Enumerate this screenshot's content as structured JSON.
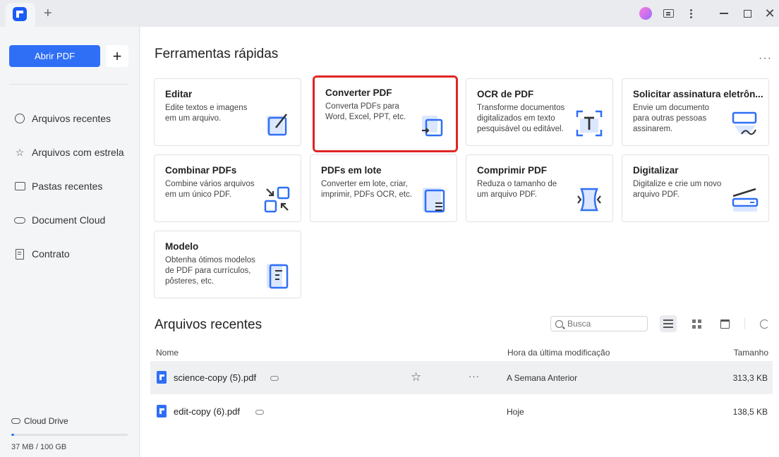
{
  "titlebar": {
    "new_tab": "+",
    "close": "✕"
  },
  "sidebar": {
    "open_button": "Abrir PDF",
    "add_button": "+",
    "items": [
      {
        "label": "Arquivos recentes",
        "icon": "clock-icon"
      },
      {
        "label": "Arquivos com estrela",
        "icon": "star-icon"
      },
      {
        "label": "Pastas recentes",
        "icon": "folder-icon"
      },
      {
        "label": "Document Cloud",
        "icon": "cloud-icon"
      },
      {
        "label": "Contrato",
        "icon": "document-icon"
      }
    ],
    "cloud_drive_label": "Cloud Drive",
    "storage_text": "37 MB / 100 GB",
    "storage_used_fraction": 0.0004
  },
  "quick_tools": {
    "title": "Ferramentas rápidas",
    "more": "···",
    "cards": [
      {
        "title": "Editar",
        "desc": "Edite textos e imagens em um arquivo."
      },
      {
        "title": "Converter PDF",
        "desc": "Converta PDFs para Word, Excel, PPT, etc."
      },
      {
        "title": "OCR de PDF",
        "desc": "Transforme documentos digitalizados em texto pesquisável ou editável."
      },
      {
        "title": "Solicitar assinatura eletrôn...",
        "desc": "Envie um documento para outras pessoas assinarem."
      },
      {
        "title": "Combinar PDFs",
        "desc": "Combine vários arquivos em um único PDF."
      },
      {
        "title": "PDFs em lote",
        "desc": "Converter em lote, criar, imprimir, PDFs OCR, etc."
      },
      {
        "title": "Comprimir PDF",
        "desc": "Reduza o tamanho de um arquivo PDF."
      },
      {
        "title": "Digitalizar",
        "desc": "Digitalize e crie um novo arquivo PDF."
      },
      {
        "title": "Modelo",
        "desc": "Obtenha ótimos modelos de PDF para currículos, pôsteres, etc."
      }
    ]
  },
  "recent": {
    "title": "Arquivos recentes",
    "search_placeholder": "Busca",
    "columns": {
      "name": "Nome",
      "modified": "Hora da última modificação",
      "size": "Tamanho"
    },
    "rows": [
      {
        "name": "science-copy (5).pdf",
        "modified": "A Semana Anterior",
        "size": "313,3 KB",
        "more": "···"
      },
      {
        "name": "edit-copy (6).pdf",
        "modified": "Hoje",
        "size": "138,5 KB"
      }
    ]
  },
  "colors": {
    "accent": "#2f6ff6",
    "highlight": "#e02424"
  }
}
